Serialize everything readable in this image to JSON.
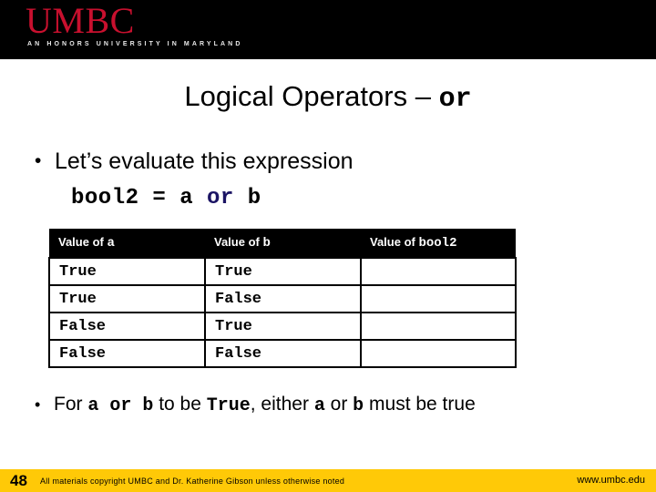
{
  "banner": {
    "logo": "UMBC",
    "tagline": "AN HONORS UNIVERSITY IN MARYLAND",
    "logo_color": "#c8102e",
    "background_color": "#000000"
  },
  "title": {
    "prefix": "Logical Operators – ",
    "operator": "or"
  },
  "bullets": {
    "first": {
      "marker": "•",
      "text": "Let’s evaluate this expression"
    },
    "second": {
      "marker": "•",
      "p1": "For ",
      "c1": "a  or  b",
      "p2": " to be ",
      "c2": "True",
      "p3": ", either ",
      "c3": "a",
      "p4": " or ",
      "c4": "b",
      "p5": " must be true"
    }
  },
  "code": {
    "pre": "bool2 = a ",
    "keyword": "or",
    "post": " b",
    "keyword_color": "#1b1464"
  },
  "table": {
    "headers": [
      {
        "label": "Value of ",
        "mono": "a"
      },
      {
        "label": "Value of ",
        "mono": "b"
      },
      {
        "label": "Value of ",
        "mono": "bool2"
      }
    ],
    "rows": [
      {
        "a": "True",
        "b": "True",
        "result": ""
      },
      {
        "a": "True",
        "b": "False",
        "result": ""
      },
      {
        "a": "False",
        "b": "True",
        "result": ""
      },
      {
        "a": "False",
        "b": "False",
        "result": ""
      }
    ]
  },
  "footer": {
    "page_number": "48",
    "copyright": "All materials copyright UMBC and Dr. Katherine Gibson unless otherwise noted",
    "url": "www.umbc.edu",
    "background_color": "#ffc907"
  }
}
